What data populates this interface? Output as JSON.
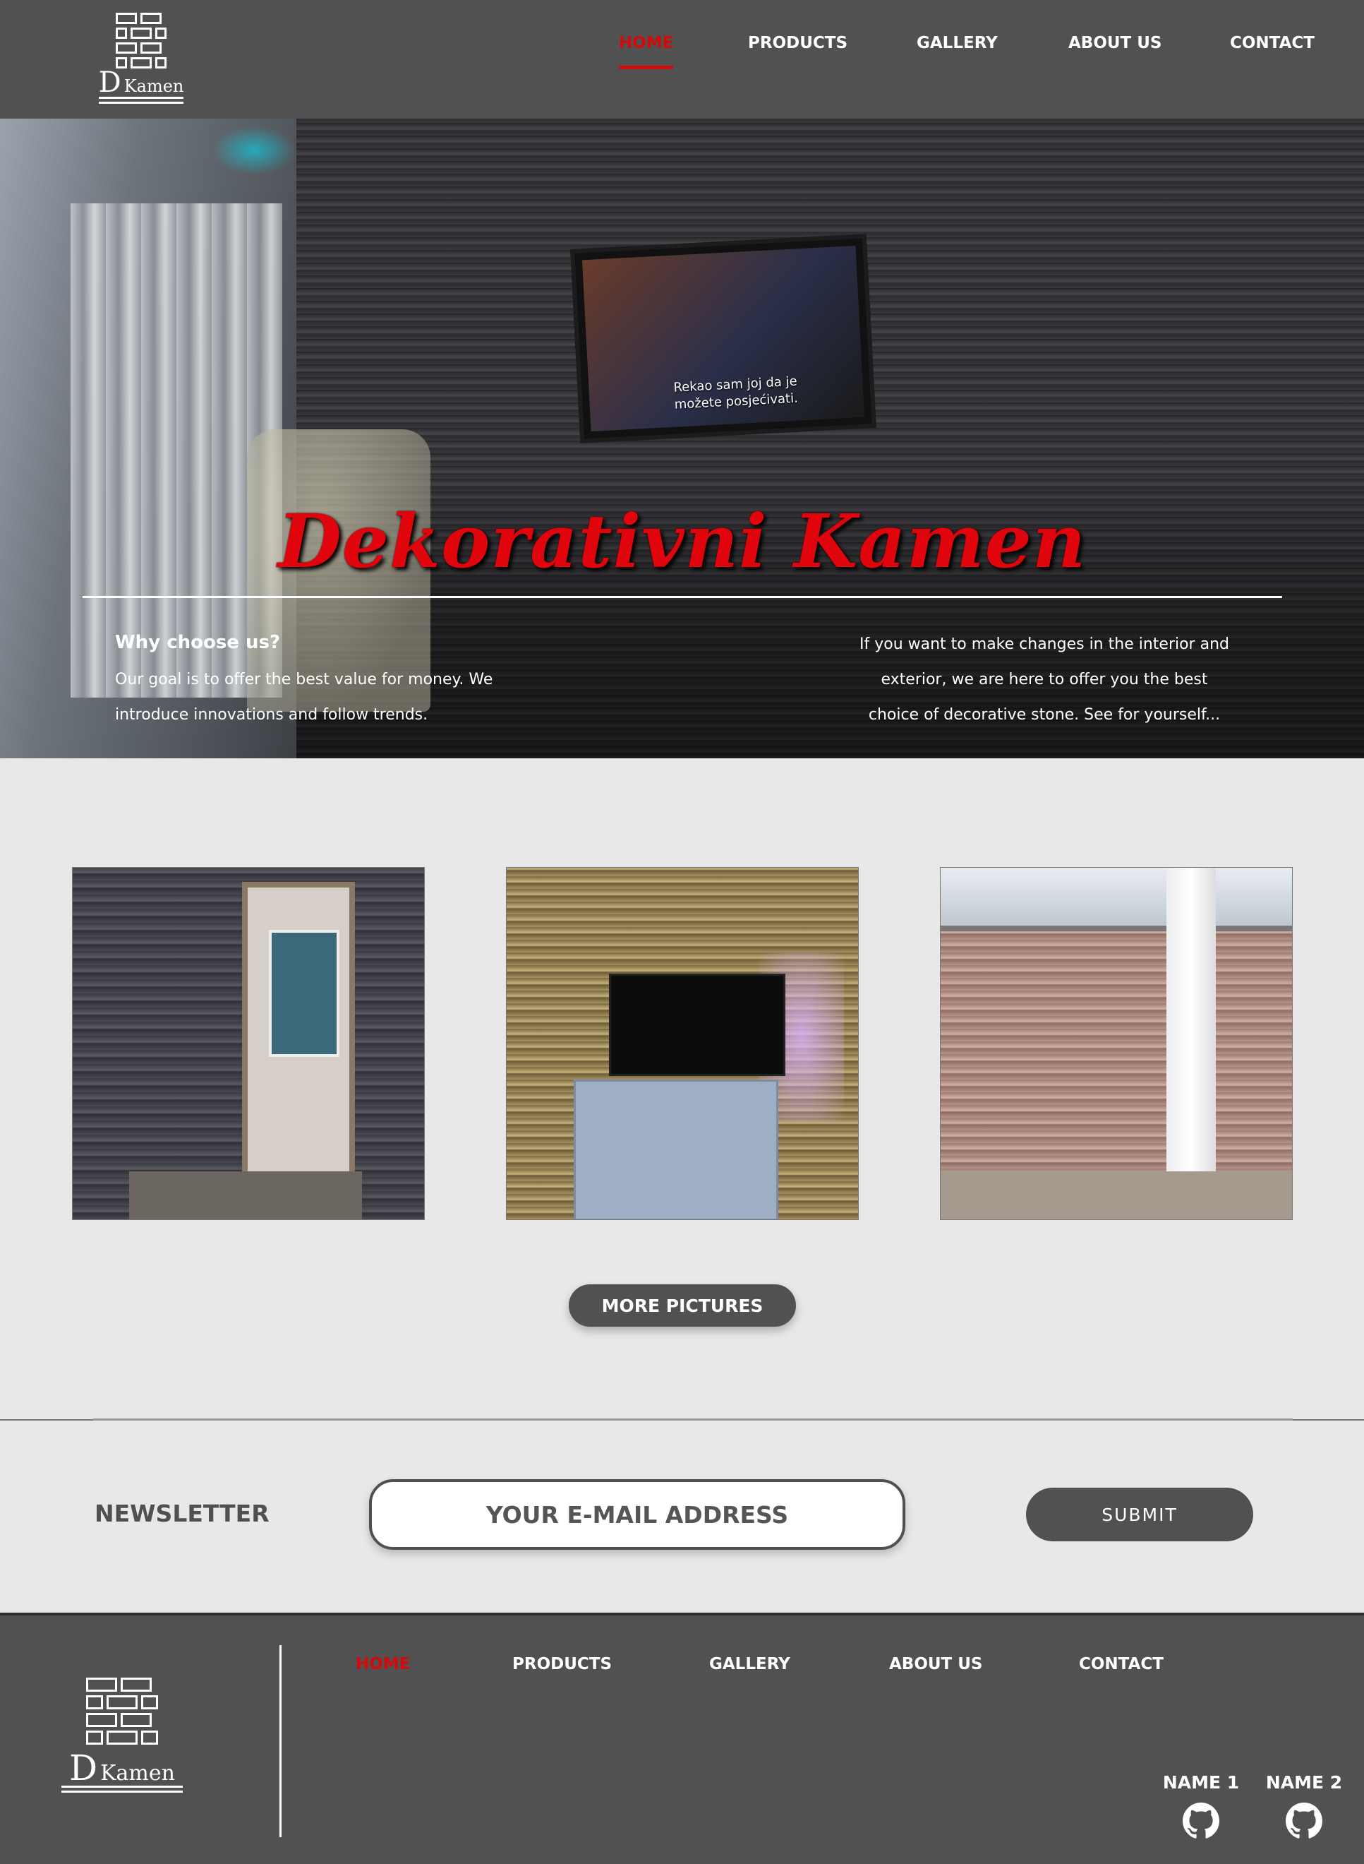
{
  "brand": {
    "logo_big": "D",
    "logo_small": "Kamen"
  },
  "nav": {
    "items": [
      {
        "label": "HOME",
        "active": true
      },
      {
        "label": "PRODUCTS",
        "active": false
      },
      {
        "label": "GALLERY",
        "active": false
      },
      {
        "label": "ABOUT US",
        "active": false
      },
      {
        "label": "CONTACT",
        "active": false
      }
    ]
  },
  "hero": {
    "title": "Dekorativni Kamen",
    "tv_subtitle_line1": "Rekao sam joj da je",
    "tv_subtitle_line2": "možete posjećivati.",
    "why_title": "Why choose us?",
    "why_text": "Our goal is to offer the best value for money. We introduce innovations and follow trends.",
    "right_text": "If you want to make changes in the interior and exterior, we are here to offer you the best choice of decorative stone. See for yourself..."
  },
  "gallery": {
    "more_label": "MORE PICTURES"
  },
  "newsletter": {
    "label": "NEWSLETTER",
    "placeholder": "YOUR E-MAIL ADDRESS",
    "submit_label": "SUBMIT"
  },
  "footer": {
    "authors": [
      {
        "name": "NAME 1",
        "icon": "github-icon"
      },
      {
        "name": "NAME 2",
        "icon": "github-icon"
      }
    ]
  },
  "colors": {
    "accent": "#d40a0a",
    "header_bg": "#515151",
    "page_bg": "#e8e8e8"
  }
}
